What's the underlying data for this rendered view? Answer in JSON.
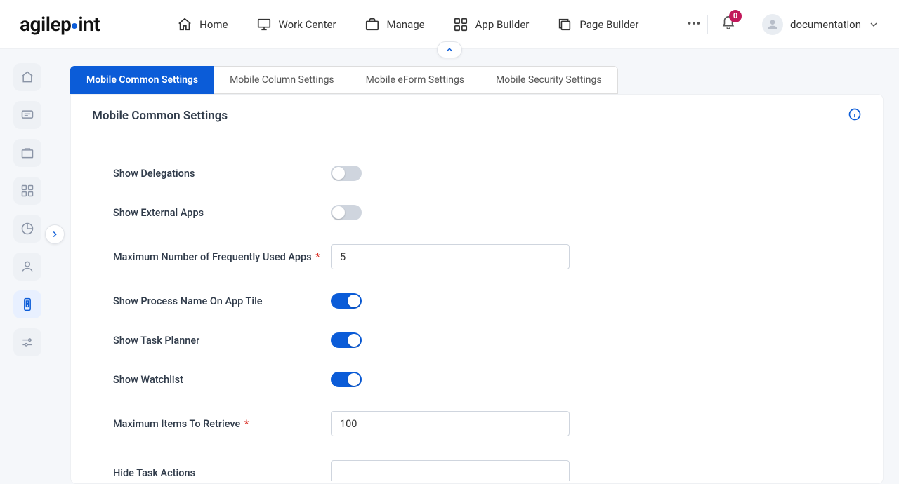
{
  "brand": "agilepoint",
  "topnav": {
    "home": "Home",
    "work_center": "Work Center",
    "manage": "Manage",
    "app_builder": "App Builder",
    "page_builder": "Page Builder"
  },
  "notifications": {
    "count": "0"
  },
  "user": {
    "name": "documentation"
  },
  "tabs": {
    "common": "Mobile Common Settings",
    "column": "Mobile Column Settings",
    "eform": "Mobile eForm Settings",
    "security": "Mobile Security Settings"
  },
  "panel": {
    "title": "Mobile Common Settings"
  },
  "fields": {
    "show_delegations": {
      "label": "Show Delegations",
      "value": false
    },
    "show_external_apps": {
      "label": "Show External Apps",
      "value": false
    },
    "max_freq_apps": {
      "label": "Maximum Number of Frequently Used Apps",
      "required": true,
      "value": "5"
    },
    "show_process_name": {
      "label": "Show Process Name On App Tile",
      "value": true
    },
    "show_task_planner": {
      "label": "Show Task Planner",
      "value": true
    },
    "show_watchlist": {
      "label": "Show Watchlist",
      "value": true
    },
    "max_items_retrieve": {
      "label": "Maximum Items To Retrieve",
      "required": true,
      "value": "100"
    },
    "hide_task_actions": {
      "label": "Hide Task Actions",
      "value": ""
    }
  }
}
